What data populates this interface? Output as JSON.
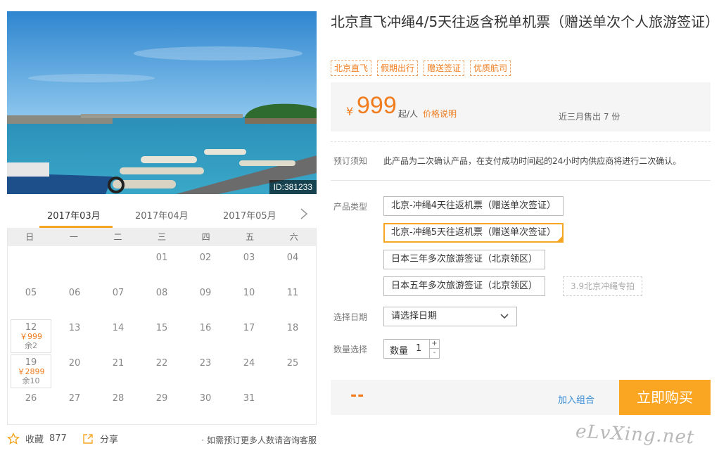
{
  "photo": {
    "id_label": "ID:381233"
  },
  "months": [
    "2017年03月",
    "2017年04月",
    "2017年05月"
  ],
  "weekdays": [
    "日",
    "一",
    "二",
    "三",
    "四",
    "五",
    "六"
  ],
  "calendar_days": [
    "01",
    "02",
    "03",
    "04",
    "05",
    "06",
    "07",
    "08",
    "09",
    "10",
    "11",
    "12",
    "13",
    "14",
    "15",
    "16",
    "17",
    "18",
    "19",
    "20",
    "21",
    "22",
    "23",
    "24",
    "25",
    "26",
    "27",
    "28",
    "29",
    "30",
    "31"
  ],
  "availability": {
    "d12": {
      "price": "￥999",
      "left": "余2"
    },
    "d19": {
      "price": "￥2899",
      "left": "余10"
    }
  },
  "actions": {
    "favorite_label": "收藏",
    "favorite_count": "877",
    "share_label": "分享",
    "consult_text": "· 如需预订更多人数请咨询客服"
  },
  "product": {
    "title": "北京直飞冲绳4/5天往返含税单机票（赠送单次个人旅游签证）",
    "tags": [
      "北京直飞",
      "假期出行",
      "赠送签证",
      "优质航司"
    ],
    "price_symbol": "¥",
    "price": "999",
    "price_unit": "起/人",
    "price_explain": "价格说明",
    "sold": "近三月售出 7 份"
  },
  "booking": {
    "notice_label": "预订须知",
    "notice_text": "此产品为二次确认产品，在支付成功时间起的24小时内供应商将进行二次确认。",
    "type_label": "产品类型",
    "types": [
      "北京-冲绳4天往返机票（赠送单次签证）",
      "北京-冲绳5天往返机票（赠送单次签证）",
      "日本三年多次旅游签证（北京领区）",
      "日本五年多次旅游签证（北京领区）"
    ],
    "special_tag": "3.9北京冲绳专拍",
    "date_label": "选择日期",
    "date_placeholder": "请选择日期",
    "qty_label": "数量选择",
    "qty_field_label": "数量",
    "qty_value": "1",
    "qty_plus": "+",
    "qty_minus": "-"
  },
  "footer": {
    "total": "--",
    "add_combo": "加入组合",
    "buy_now": "立即购买"
  },
  "watermark": "eLvXing.net",
  "colors": {
    "accent": "#f5a623",
    "price": "#f07c1e",
    "link": "#3b8fd8"
  }
}
